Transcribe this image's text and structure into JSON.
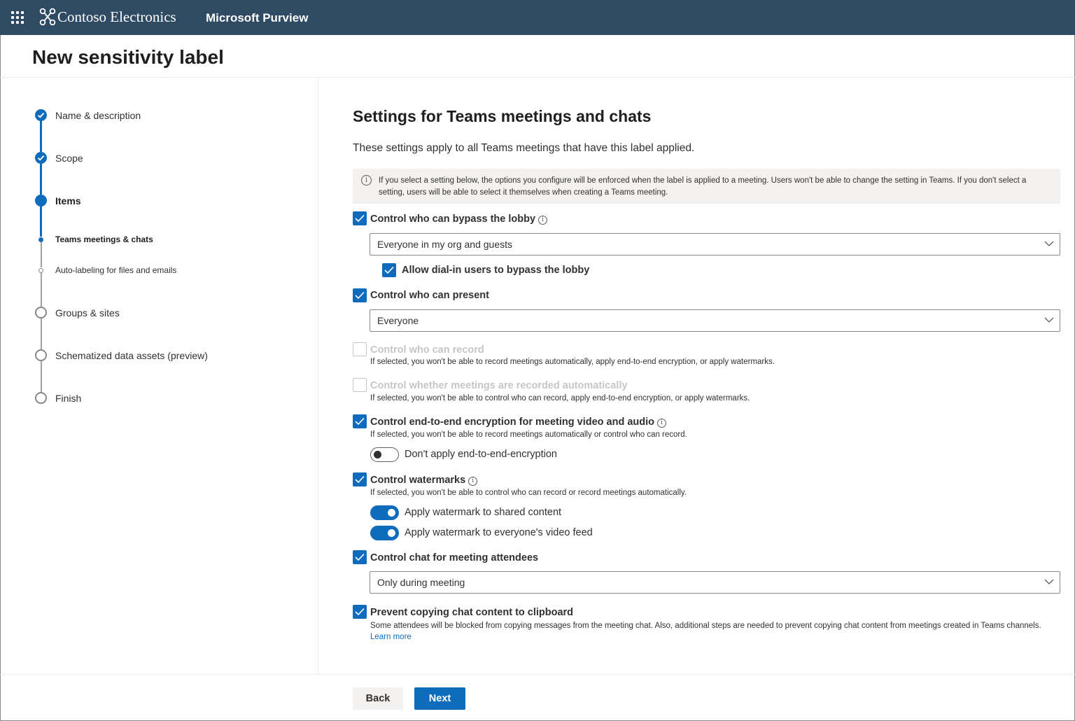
{
  "topbar": {
    "brand": "Contoso Electronics",
    "app": "Microsoft Purview"
  },
  "page": {
    "title": "New sensitivity label"
  },
  "steps": [
    {
      "label": "Name & description",
      "state": "done"
    },
    {
      "label": "Scope",
      "state": "done"
    },
    {
      "label": "Items",
      "state": "current"
    },
    {
      "label": "Teams meetings & chats",
      "state": "current-sub"
    },
    {
      "label": "Auto-labeling for files and emails",
      "state": "todo-sub"
    },
    {
      "label": "Groups & sites",
      "state": "todo"
    },
    {
      "label": "Schematized data assets (preview)",
      "state": "todo"
    },
    {
      "label": "Finish",
      "state": "todo"
    }
  ],
  "content": {
    "title": "Settings for Teams meetings and chats",
    "description": "These settings apply to all Teams meetings that have this label applied.",
    "info": "If you select a setting below, the options you configure will be enforced when the label is applied to a meeting. Users won't be able to change the setting in Teams. If you don't select a setting, users will be able to select it themselves when creating a Teams meeting."
  },
  "settings": {
    "lobby": {
      "label": "Control who can bypass the lobby",
      "checked": true,
      "dropdown_value": "Everyone in my org and guests",
      "dialin_label": "Allow dial-in users to bypass the lobby",
      "dialin_checked": true
    },
    "present": {
      "label": "Control who can present",
      "checked": true,
      "dropdown_value": "Everyone"
    },
    "record": {
      "label": "Control who can record",
      "checked": false,
      "help": "If selected, you won't be able to record meetings automatically, apply end-to-end encryption, or apply watermarks."
    },
    "auto_record": {
      "label": "Control whether meetings are recorded automatically",
      "checked": false,
      "help": "If selected, you won't be able to control who can record, apply end-to-end encryption, or apply watermarks."
    },
    "encryption": {
      "label": "Control end-to-end encryption for meeting video and audio",
      "checked": true,
      "help": "If selected, you won't be able to record meetings automatically or control who can record.",
      "toggle_label": "Don't apply end-to-end-encryption",
      "toggle_on": false
    },
    "watermarks": {
      "label": "Control watermarks",
      "checked": true,
      "help": "If selected, you won't be able to control who can record or record meetings automatically.",
      "toggle1_label": "Apply watermark to shared content",
      "toggle1_on": true,
      "toggle2_label": "Apply watermark to everyone's video feed",
      "toggle2_on": true
    },
    "chat": {
      "label": "Control chat for meeting attendees",
      "checked": true,
      "dropdown_value": "Only during meeting"
    },
    "clipboard": {
      "label": "Prevent copying chat content to clipboard",
      "checked": true,
      "help": "Some attendees will be blocked from copying messages from the meeting chat. Also, additional steps are needed to prevent copying chat content from meetings created in Teams channels.",
      "link": "Learn more"
    }
  },
  "footer": {
    "back": "Back",
    "next": "Next"
  },
  "colors": {
    "topbar": "#2f4a63",
    "accent": "#0f6cbd"
  }
}
